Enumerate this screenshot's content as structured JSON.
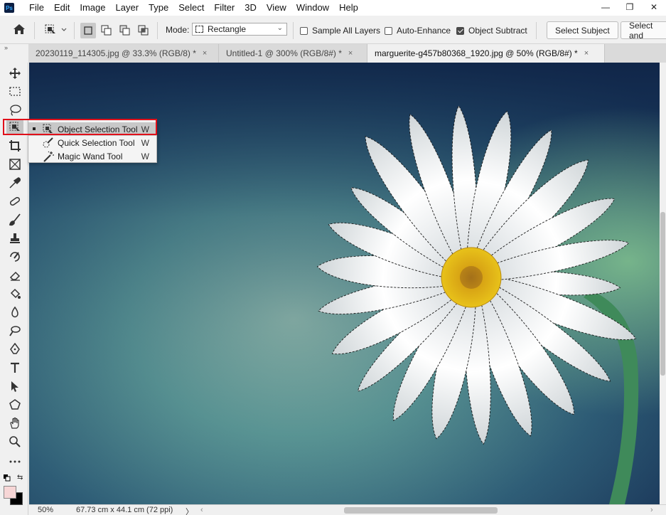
{
  "app": {
    "logo_text": "Ps"
  },
  "menu": [
    "File",
    "Edit",
    "Image",
    "Layer",
    "Type",
    "Select",
    "Filter",
    "3D",
    "View",
    "Window",
    "Help"
  ],
  "window_controls": {
    "minimize": "—",
    "restore": "❐",
    "close": "✕"
  },
  "options": {
    "mode_label": "Mode:",
    "mode_value": "Rectangle",
    "sample_all_layers": {
      "label": "Sample All Layers",
      "checked": false
    },
    "auto_enhance": {
      "label": "Auto-Enhance",
      "checked": false
    },
    "object_subtract": {
      "label": "Object Subtract",
      "checked": true
    },
    "select_subject": "Select Subject",
    "select_and_mask": "Select and"
  },
  "panel_toggle": "»",
  "tabs": [
    {
      "title": "20230119_114305.jpg @ 33.3% (RGB/8) *",
      "close": "×",
      "active": false
    },
    {
      "title": "Untitled-1 @ 300% (RGB/8#) *",
      "close": "×",
      "active": false
    },
    {
      "title": "marguerite-g457b80368_1920.jpg @ 50% (RGB/8#) *",
      "close": "×",
      "active": true
    }
  ],
  "tools": [
    "move-icon",
    "marquee-icon",
    "lasso-icon",
    "object-selection-icon",
    "crop-icon",
    "frame-icon",
    "eyedropper-icon",
    "healing-icon",
    "brush-icon",
    "stamp-icon",
    "history-brush-icon",
    "eraser-icon",
    "paint-bucket-icon",
    "blur-icon",
    "dodge-icon",
    "pen-icon",
    "type-icon",
    "path-selection-icon",
    "shape-icon",
    "hand-icon",
    "zoom-icon",
    "more-icon"
  ],
  "flyout": [
    {
      "label": "Object Selection Tool",
      "shortcut": "W",
      "selected": true,
      "icon": "object-selection-icon"
    },
    {
      "label": "Quick Selection Tool",
      "shortcut": "W",
      "selected": false,
      "icon": "quick-selection-icon"
    },
    {
      "label": "Magic Wand Tool",
      "shortcut": "W",
      "selected": false,
      "icon": "magic-wand-icon"
    }
  ],
  "colors": {
    "foreground": "#f7d6d6",
    "background": "#000000",
    "highlight": "#e0101a"
  },
  "status": {
    "zoom": "50%",
    "doc_size": "67.73 cm x 44.1 cm (72 ppi)",
    "arrow": "〉"
  }
}
